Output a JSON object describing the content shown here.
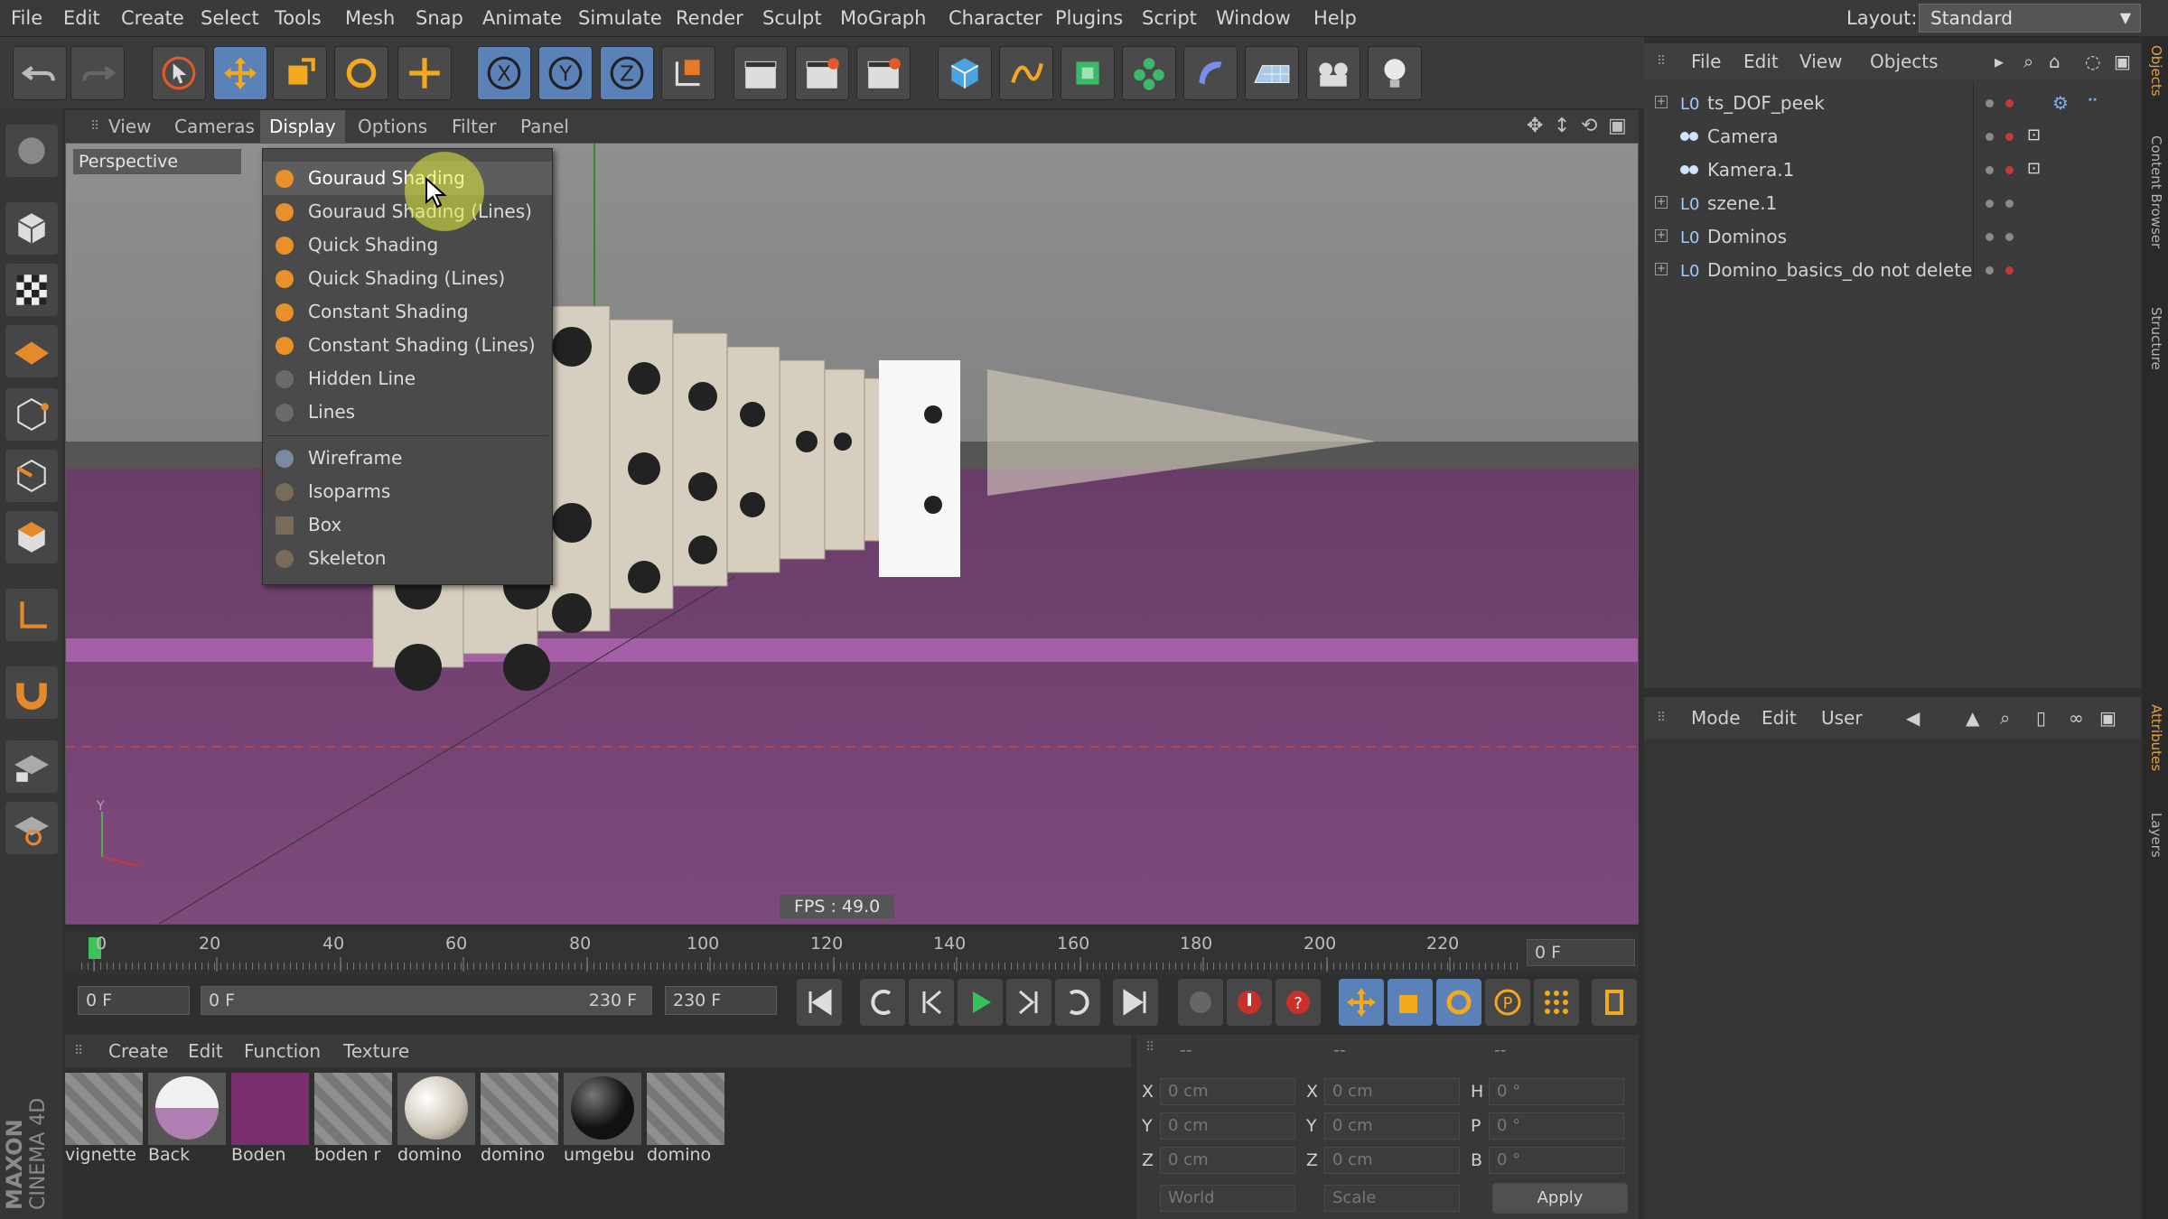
{
  "menubar": {
    "items": [
      "File",
      "Edit",
      "Create",
      "Select",
      "Tools",
      "Mesh",
      "Snap",
      "Animate",
      "Simulate",
      "Render",
      "Sculpt",
      "MoGraph",
      "Character",
      "Plugins",
      "Script",
      "Window",
      "Help"
    ],
    "layout_label": "Layout:",
    "layout_value": "Standard"
  },
  "viewport": {
    "menu": [
      "View",
      "Cameras",
      "Display",
      "Options",
      "Filter",
      "Panel"
    ],
    "camera_label": "Perspective",
    "fps": "FPS : 49.0"
  },
  "display_menu": {
    "items": [
      {
        "label": "Gouraud Shading",
        "icon": "gouraud-icon"
      },
      {
        "label": "Gouraud Shading (Lines)",
        "icon": "gouraud-lines-icon"
      },
      {
        "label": "Quick Shading",
        "icon": "quick-shading-icon"
      },
      {
        "label": "Quick Shading (Lines)",
        "icon": "quick-lines-icon"
      },
      {
        "label": "Constant Shading",
        "icon": "constant-shading-icon"
      },
      {
        "label": "Constant Shading (Lines)",
        "icon": "constant-lines-icon"
      },
      {
        "label": "Hidden Line",
        "icon": "hidden-line-icon"
      },
      {
        "label": "Lines",
        "icon": "lines-icon"
      },
      {
        "label": "Wireframe",
        "icon": "wireframe-icon"
      },
      {
        "label": "Isoparms",
        "icon": "isoparms-icon"
      },
      {
        "label": "Box",
        "icon": "box-icon"
      },
      {
        "label": "Skeleton",
        "icon": "skeleton-icon"
      }
    ]
  },
  "timeline": {
    "ticks": [
      "0",
      "20",
      "40",
      "60",
      "80",
      "100",
      "120",
      "140",
      "160",
      "180",
      "200",
      "220"
    ],
    "current_frame": "0 F",
    "start_field": "0 F",
    "range_start": "0 F",
    "range_end": "230 F",
    "end_field": "230 F"
  },
  "materials": {
    "menu": [
      "Create",
      "Edit",
      "Function",
      "Texture"
    ],
    "items": [
      {
        "name": "vignette",
        "color": "#8a8a8a"
      },
      {
        "name": "Back",
        "color": "#b27fb5"
      },
      {
        "name": "Boden",
        "color": "#7b2e6f"
      },
      {
        "name": "boden r",
        "color": "#8a8a8a"
      },
      {
        "name": "domino",
        "color": "#e9e5dc"
      },
      {
        "name": "domino",
        "color": "#8a8a8a"
      },
      {
        "name": "umgebu",
        "color": "#111111"
      },
      {
        "name": "domino",
        "color": "#8a8a8a"
      }
    ]
  },
  "coordinates": {
    "header": [
      "--",
      "--",
      "--"
    ],
    "rows": [
      {
        "a": "X",
        "av": "0 cm",
        "b": "X",
        "bv": "0 cm",
        "c": "H",
        "cv": "0 °"
      },
      {
        "a": "Y",
        "av": "0 cm",
        "b": "Y",
        "bv": "0 cm",
        "c": "P",
        "cv": "0 °"
      },
      {
        "a": "Z",
        "av": "0 cm",
        "b": "Z",
        "bv": "0 cm",
        "c": "B",
        "cv": "0 °"
      }
    ],
    "mode1": "World",
    "mode2": "Scale",
    "apply": "Apply"
  },
  "objects": {
    "menu": [
      "File",
      "Edit",
      "View",
      "Objects"
    ],
    "items": [
      "ts_DOF_peek",
      "Camera",
      "Kamera.1",
      "szene.1",
      "Dominos",
      "Domino_basics_do not delete"
    ]
  },
  "attributes": {
    "menu": [
      "Mode",
      "Edit",
      "User"
    ]
  },
  "side_tabs": [
    "Objects",
    "Content Browser",
    "Structure",
    "Attributes",
    "Layers"
  ],
  "branding": {
    "line1": "MAXON",
    "line2": "CINEMA 4D"
  },
  "colors": {
    "floor": "#7a3f78",
    "accent": "#f0a030",
    "select": "#5b82b8"
  }
}
